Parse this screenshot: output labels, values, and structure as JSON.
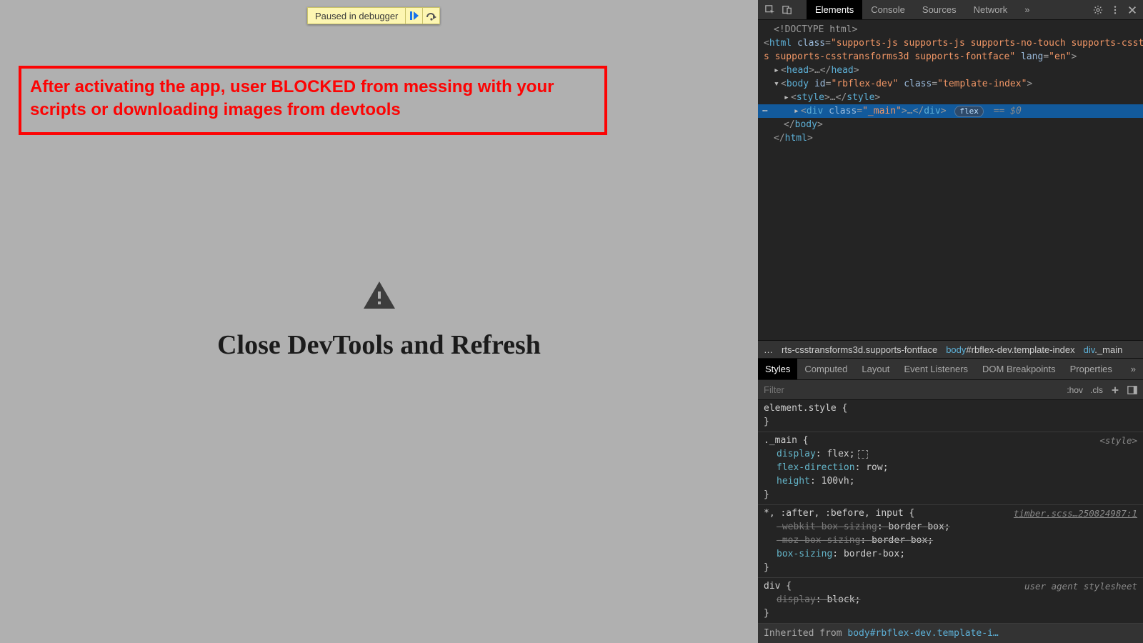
{
  "page": {
    "pause_label": "Paused in debugger",
    "annotation_text": "After activating the app, user BLOCKED from messing with your scripts or downloading images from devtools",
    "center_heading": "Close DevTools and Refresh"
  },
  "devtools": {
    "tabs": [
      "Elements",
      "Console",
      "Sources",
      "Network"
    ],
    "active_tab": "Elements",
    "dom": {
      "doctype": "<!DOCTYPE html>",
      "html_open_1": "<html class=\"supports-js supports-js supports-no-touch supports-csstransfor",
      "html_open_2": "s supports-csstransforms3d supports-fontface\" lang=\"en\">",
      "head": "<head>…</head>",
      "body_open": "<body id=\"rbflex-dev\" class=\"template-index\">",
      "style": "<style>…</style>",
      "selected": "<div class=\"_main\">…</div>",
      "flex_badge": "flex",
      "eq0": "== $0",
      "body_close": "</body>",
      "html_close": "</html>"
    },
    "breadcrumb": {
      "ell": "…",
      "item1_prefix": "rts-csstransforms3d.supports-fontface",
      "item2_tag": "body",
      "item2_suffix": "#rbflex-dev.template-index",
      "item3_tag": "div",
      "item3_suffix": "._main"
    },
    "sub_tabs": [
      "Styles",
      "Computed",
      "Layout",
      "Event Listeners",
      "DOM Breakpoints",
      "Properties"
    ],
    "active_sub_tab": "Styles",
    "filter": {
      "placeholder": "Filter",
      "hov": ":hov",
      "cls": ".cls"
    },
    "styles": {
      "block0": {
        "selector": "element.style {",
        "close": "}"
      },
      "block1": {
        "selector": "._main {",
        "src": "<style>",
        "p1": {
          "name": "display",
          "value": "flex;"
        },
        "p2": {
          "name": "flex-direction",
          "value": "row;"
        },
        "p3": {
          "name": "height",
          "value": "100vh;"
        },
        "close": "}"
      },
      "block2": {
        "selector": "*, :after, :before, input {",
        "src": "timber.scss…250824987:1",
        "p1": {
          "name": "-webkit-box-sizing",
          "value": "border-box;"
        },
        "p2": {
          "name": "-moz-box-sizing",
          "value": "border-box;"
        },
        "p3": {
          "name": "box-sizing",
          "value": "border-box;"
        },
        "close": "}"
      },
      "block3": {
        "selector": "div {",
        "src": "user agent stylesheet",
        "p1": {
          "name": "display",
          "value": "block;"
        },
        "close": "}"
      },
      "inherit": {
        "label": "Inherited from ",
        "link": "body#rbflex-dev.template-i…"
      }
    }
  }
}
